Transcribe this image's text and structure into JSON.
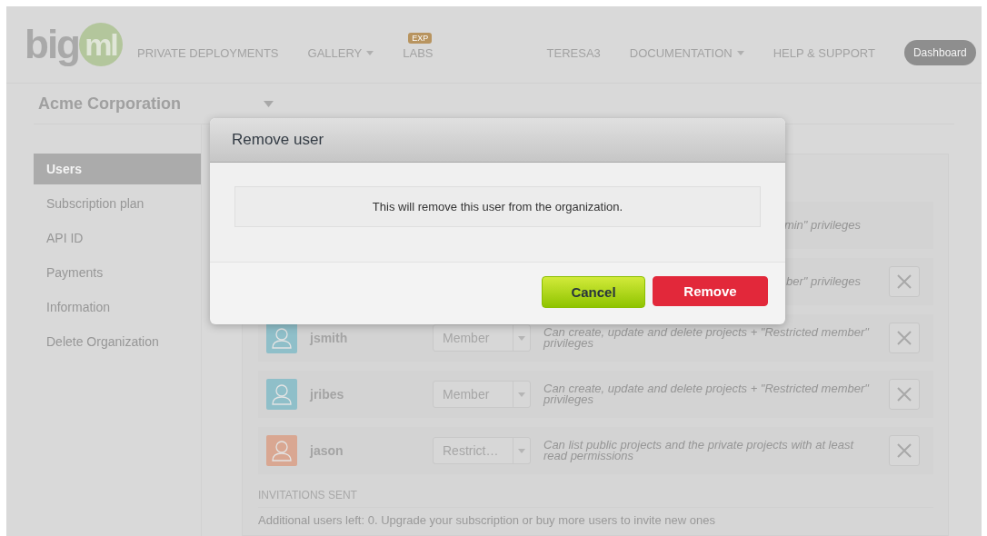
{
  "nav": {
    "logo": "bigml",
    "items": [
      {
        "label": "PRIVATE DEPLOYMENTS",
        "dropdown": false
      },
      {
        "label": "GALLERY",
        "dropdown": true
      },
      {
        "label": "LABS",
        "dropdown": false,
        "badge": "EXP"
      },
      {
        "label": "TERESA3",
        "dropdown": false
      },
      {
        "label": "DOCUMENTATION",
        "dropdown": true
      },
      {
        "label": "HELP & SUPPORT",
        "dropdown": false
      }
    ],
    "dashboard": "Dashboard"
  },
  "organization": {
    "name": "Acme Corporation"
  },
  "sidebar": {
    "items": [
      {
        "label": "Users",
        "selected": true
      },
      {
        "label": "Subscription plan",
        "selected": false
      },
      {
        "label": "API ID",
        "selected": false
      },
      {
        "label": "Payments",
        "selected": false
      },
      {
        "label": "Information",
        "selected": false
      },
      {
        "label": "Delete Organization",
        "selected": false
      }
    ]
  },
  "users": [
    {
      "description": "min\" privileges",
      "removable": false
    },
    {
      "description": "ber\" privileges",
      "removable": true
    },
    {
      "name": "jsmith",
      "role": "Member",
      "color": "#8fbfc9",
      "description": "Can create, update and delete projects + \"Restricted member\" privileges",
      "removable": true
    },
    {
      "name": "jribes",
      "role": "Member",
      "color": "#8fbfc9",
      "description": "Can create, update and delete projects + \"Restricted member\" privileges",
      "removable": true
    },
    {
      "name": "jason",
      "role": "Restrict…",
      "color": "#d9a792",
      "description": "Can list public projects and the private projects with at least read permissions",
      "removable": true
    }
  ],
  "invitations": {
    "heading": "INVITATIONS SENT",
    "note": "Additional users left: 0. Upgrade your subscription or buy more users to invite new ones"
  },
  "dialog": {
    "title": "Remove user",
    "message": "This will remove this user from the organization.",
    "buttons": [
      {
        "label": "Cancel",
        "kind": "cancel"
      },
      {
        "label": "Remove",
        "kind": "danger"
      }
    ]
  }
}
